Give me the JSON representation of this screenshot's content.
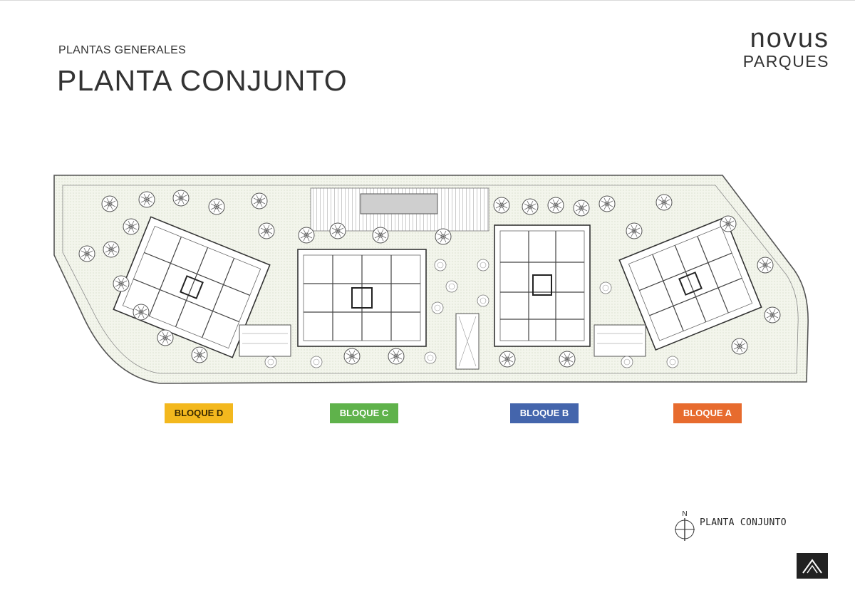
{
  "header": {
    "subtitle": "PLANTAS GENERALES",
    "title": "PLANTA CONJUNTO"
  },
  "brand": {
    "name": "novus",
    "sub": "PARQUES"
  },
  "blocks": [
    {
      "label": "BLOQUE D",
      "color": "#f3b81e",
      "text_color": "#3a2a00"
    },
    {
      "label": "BLOQUE C",
      "color": "#5fb24b",
      "text_color": "#ffffff"
    },
    {
      "label": "BLOQUE B",
      "color": "#4465ac",
      "text_color": "#ffffff"
    },
    {
      "label": "BLOQUE A",
      "color": "#e76b2e",
      "text_color": "#ffffff"
    }
  ],
  "north": {
    "letter": "N",
    "caption": "PLANTA CONJUNTO"
  }
}
